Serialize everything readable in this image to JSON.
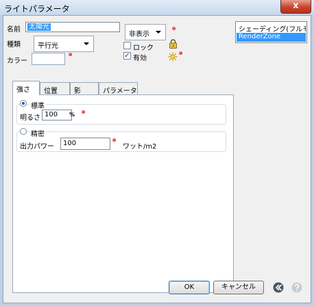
{
  "window": {
    "title": "ライトパラメータ",
    "close_glyph": "x"
  },
  "fields": {
    "name_label": "名前",
    "name_value": "太陽光",
    "type_label": "種類",
    "type_value": "平行光",
    "color_label": "カラー",
    "visibility_value": "非表示",
    "lock_label": "ロック",
    "lock_checked": false,
    "enabled_label": "有効",
    "enabled_checked": true,
    "enabled_mark": "✓"
  },
  "list": {
    "items": [
      "シェーディング(フルモ",
      "RenderZone"
    ],
    "selected_index": 1
  },
  "tabs": [
    "強さ",
    "位置",
    "影",
    "パラメータ"
  ],
  "active_tab_index": 0,
  "intensity": {
    "standard_label": "標準",
    "standard_selected": true,
    "brightness_label": "明るさ",
    "brightness_value": "100",
    "brightness_unit": "%",
    "precise_label": "精密",
    "precise_selected": false,
    "power_label": "出力パワー",
    "power_value": "100",
    "power_unit": "ワット/m2"
  },
  "buttons": {
    "ok": "OK",
    "cancel": "キャンセル"
  },
  "icons": {
    "lock": "padlock-icon",
    "sun": "sun-icon",
    "back": "back-arrow-icon",
    "help": "help-icon",
    "marker": "red-dot-icon"
  },
  "colors": {
    "selection": "#3399ff",
    "marker": "#c80000",
    "color_swatch": "#ffffff"
  }
}
